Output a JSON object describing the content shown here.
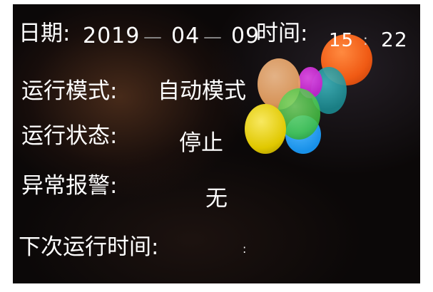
{
  "datetime": {
    "date_label": "日期:",
    "year": "2019",
    "date_separator_1": "—",
    "month": "04",
    "date_separator_2": "—",
    "day": "09",
    "time_label": "时间:",
    "hour": "15",
    "time_separator": ":",
    "minute": "22"
  },
  "status": {
    "mode_label": "运行模式:",
    "mode_value": "自动模式",
    "state_label": "运行状态:",
    "state_value": "停止",
    "alarm_label": "异常报警:",
    "alarm_value": "无",
    "next_run_label": "下次运行时间:",
    "next_run_value": ":"
  },
  "colors": {
    "background": "#0b0808",
    "text": "#ffffff",
    "separator": "#8a8a8a",
    "balloon_orange": "#f05a14",
    "balloon_peach": "#e8a060",
    "balloon_magenta": "#c020c8",
    "balloon_teal": "#1a8a90",
    "balloon_green": "#40c040",
    "balloon_yellow": "#e0c800",
    "balloon_blue": "#1890e8"
  },
  "decoration": {
    "name": "balloons-graphic"
  }
}
